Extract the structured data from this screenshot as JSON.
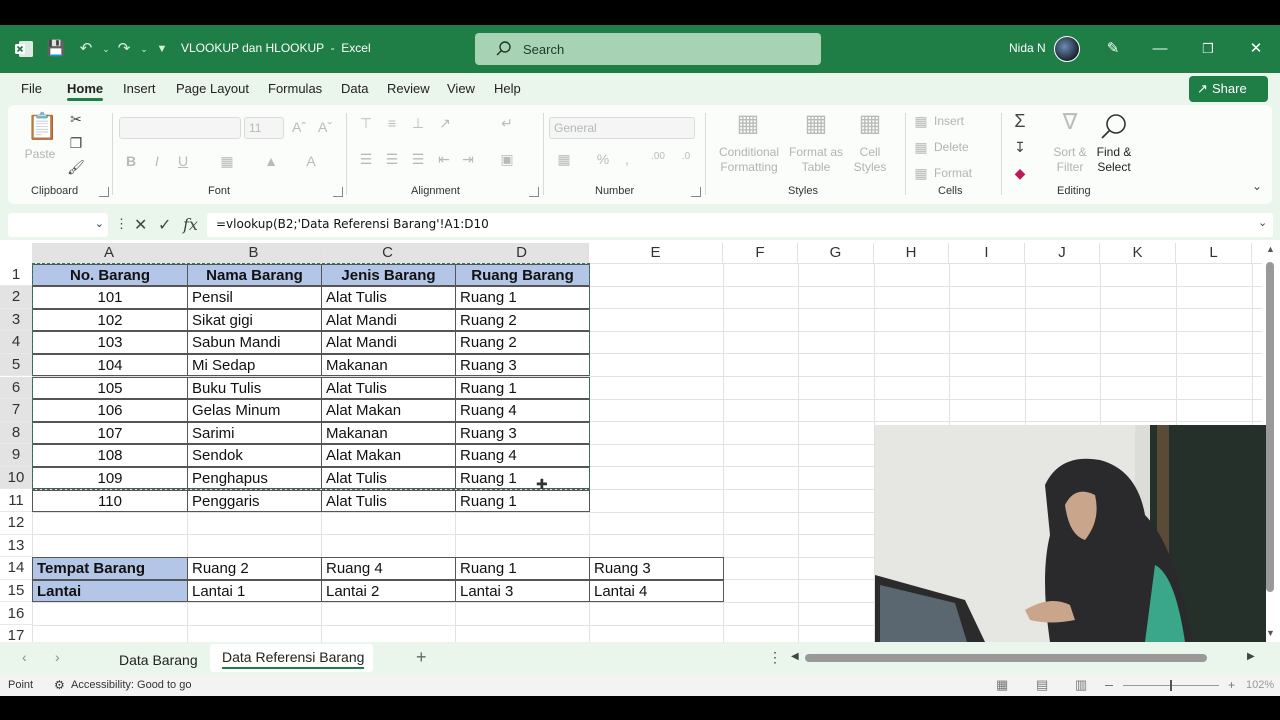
{
  "app": {
    "doc_title": "VLOOKUP dan HLOOKUP  -  Excel",
    "search_placeholder": "Search",
    "user_name": "Nida N"
  },
  "ribbon": {
    "tabs": [
      "File",
      "Home",
      "Insert",
      "Page Layout",
      "Formulas",
      "Data",
      "Review",
      "View",
      "Help"
    ],
    "share_label": "Share",
    "groups": {
      "clipboard": "Clipboard",
      "font": "Font",
      "alignment": "Alignment",
      "number": "Number",
      "styles": "Styles",
      "cells": "Cells",
      "editing": "Editing"
    },
    "paste": "Paste",
    "font_size": "11",
    "number_format": "General",
    "conditional_formatting": [
      "Conditional",
      "Formatting"
    ],
    "format_as_table": [
      "Format as",
      "Table"
    ],
    "cell_styles": [
      "Cell",
      "Styles"
    ],
    "insert": "Insert",
    "delete": "Delete",
    "format": "Format",
    "sort_filter": [
      "Sort &",
      "Filter"
    ],
    "find_select": [
      "Find &",
      "Select"
    ]
  },
  "formula_bar": {
    "formula": "=vlookup(B2;'Data Referensi Barang'!A1:D10"
  },
  "sheet": {
    "columns": [
      "A",
      "B",
      "C",
      "D",
      "E",
      "F",
      "G",
      "H",
      "I",
      "J",
      "K",
      "L"
    ],
    "rows": [
      "1",
      "2",
      "3",
      "4",
      "5",
      "6",
      "7",
      "8",
      "9",
      "10",
      "11",
      "12",
      "13",
      "14",
      "15",
      "16",
      "17"
    ],
    "table_headers": [
      "No. Barang",
      "Nama Barang",
      "Jenis Barang",
      "Ruang Barang"
    ],
    "table_rows": [
      [
        "101",
        "Pensil",
        "Alat Tulis",
        "Ruang 1"
      ],
      [
        "102",
        "Sikat gigi",
        "Alat Mandi",
        "Ruang 2"
      ],
      [
        "103",
        "Sabun Mandi",
        "Alat Mandi",
        "Ruang 2"
      ],
      [
        "104",
        "Mi Sedap",
        "Makanan",
        "Ruang 3"
      ],
      [
        "105",
        "Buku Tulis",
        "Alat Tulis",
        "Ruang 1"
      ],
      [
        "106",
        "Gelas Minum",
        "Alat Makan",
        "Ruang 4"
      ],
      [
        "107",
        "Sarimi",
        "Makanan",
        "Ruang 3"
      ],
      [
        "108",
        "Sendok",
        "Alat Makan",
        "Ruang 4"
      ],
      [
        "109",
        "Penghapus",
        "Alat Tulis",
        "Ruang 1"
      ],
      [
        "110",
        "Penggaris",
        "Alat Tulis",
        "Ruang 1"
      ]
    ],
    "htable": [
      {
        "label": "Tempat Barang",
        "values": [
          "Ruang 2",
          "Ruang 4",
          "Ruang 1",
          "Ruang 3"
        ]
      },
      {
        "label": "Lantai",
        "values": [
          "Lantai 1",
          "Lantai 2",
          "Lantai 3",
          "Lantai 4"
        ]
      }
    ]
  },
  "sheet_tabs": [
    "Data Barang",
    "Data Referensi Barang"
  ],
  "status": {
    "mode": "Point",
    "accessibility": "Accessibility: Good to go",
    "zoom": "102%"
  },
  "colors": {
    "excel_green": "#1e7e45",
    "header_fill": "#b4c6e7"
  }
}
